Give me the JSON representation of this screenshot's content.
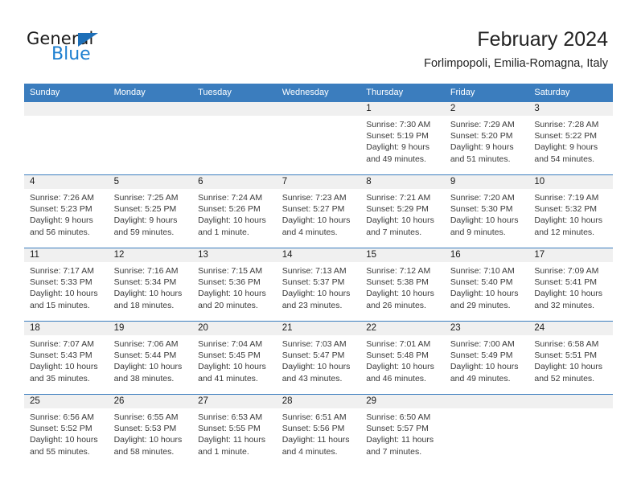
{
  "brand": {
    "name_top": "General",
    "name_bottom": "Blue",
    "accent_color": "#1d7fd0",
    "triangle_color": "#1d6fb8"
  },
  "header": {
    "title": "February 2024",
    "subtitle": "Forlimpopoli, Emilia-Romagna, Italy"
  },
  "theme": {
    "header_blue": "#3b7dbe",
    "band_gray": "#f0f0f0",
    "text_dark": "#1a1a1a",
    "text_body": "#3a3a3a"
  },
  "weekdays": [
    "Sunday",
    "Monday",
    "Tuesday",
    "Wednesday",
    "Thursday",
    "Friday",
    "Saturday"
  ],
  "weeks": [
    [
      {
        "day": "",
        "sunrise": "",
        "sunset": "",
        "daylight_line1": "",
        "daylight_line2": ""
      },
      {
        "day": "",
        "sunrise": "",
        "sunset": "",
        "daylight_line1": "",
        "daylight_line2": ""
      },
      {
        "day": "",
        "sunrise": "",
        "sunset": "",
        "daylight_line1": "",
        "daylight_line2": ""
      },
      {
        "day": "",
        "sunrise": "",
        "sunset": "",
        "daylight_line1": "",
        "daylight_line2": ""
      },
      {
        "day": "1",
        "sunrise": "Sunrise: 7:30 AM",
        "sunset": "Sunset: 5:19 PM",
        "daylight_line1": "Daylight: 9 hours",
        "daylight_line2": "and 49 minutes."
      },
      {
        "day": "2",
        "sunrise": "Sunrise: 7:29 AM",
        "sunset": "Sunset: 5:20 PM",
        "daylight_line1": "Daylight: 9 hours",
        "daylight_line2": "and 51 minutes."
      },
      {
        "day": "3",
        "sunrise": "Sunrise: 7:28 AM",
        "sunset": "Sunset: 5:22 PM",
        "daylight_line1": "Daylight: 9 hours",
        "daylight_line2": "and 54 minutes."
      }
    ],
    [
      {
        "day": "4",
        "sunrise": "Sunrise: 7:26 AM",
        "sunset": "Sunset: 5:23 PM",
        "daylight_line1": "Daylight: 9 hours",
        "daylight_line2": "and 56 minutes."
      },
      {
        "day": "5",
        "sunrise": "Sunrise: 7:25 AM",
        "sunset": "Sunset: 5:25 PM",
        "daylight_line1": "Daylight: 9 hours",
        "daylight_line2": "and 59 minutes."
      },
      {
        "day": "6",
        "sunrise": "Sunrise: 7:24 AM",
        "sunset": "Sunset: 5:26 PM",
        "daylight_line1": "Daylight: 10 hours",
        "daylight_line2": "and 1 minute."
      },
      {
        "day": "7",
        "sunrise": "Sunrise: 7:23 AM",
        "sunset": "Sunset: 5:27 PM",
        "daylight_line1": "Daylight: 10 hours",
        "daylight_line2": "and 4 minutes."
      },
      {
        "day": "8",
        "sunrise": "Sunrise: 7:21 AM",
        "sunset": "Sunset: 5:29 PM",
        "daylight_line1": "Daylight: 10 hours",
        "daylight_line2": "and 7 minutes."
      },
      {
        "day": "9",
        "sunrise": "Sunrise: 7:20 AM",
        "sunset": "Sunset: 5:30 PM",
        "daylight_line1": "Daylight: 10 hours",
        "daylight_line2": "and 9 minutes."
      },
      {
        "day": "10",
        "sunrise": "Sunrise: 7:19 AM",
        "sunset": "Sunset: 5:32 PM",
        "daylight_line1": "Daylight: 10 hours",
        "daylight_line2": "and 12 minutes."
      }
    ],
    [
      {
        "day": "11",
        "sunrise": "Sunrise: 7:17 AM",
        "sunset": "Sunset: 5:33 PM",
        "daylight_line1": "Daylight: 10 hours",
        "daylight_line2": "and 15 minutes."
      },
      {
        "day": "12",
        "sunrise": "Sunrise: 7:16 AM",
        "sunset": "Sunset: 5:34 PM",
        "daylight_line1": "Daylight: 10 hours",
        "daylight_line2": "and 18 minutes."
      },
      {
        "day": "13",
        "sunrise": "Sunrise: 7:15 AM",
        "sunset": "Sunset: 5:36 PM",
        "daylight_line1": "Daylight: 10 hours",
        "daylight_line2": "and 20 minutes."
      },
      {
        "day": "14",
        "sunrise": "Sunrise: 7:13 AM",
        "sunset": "Sunset: 5:37 PM",
        "daylight_line1": "Daylight: 10 hours",
        "daylight_line2": "and 23 minutes."
      },
      {
        "day": "15",
        "sunrise": "Sunrise: 7:12 AM",
        "sunset": "Sunset: 5:38 PM",
        "daylight_line1": "Daylight: 10 hours",
        "daylight_line2": "and 26 minutes."
      },
      {
        "day": "16",
        "sunrise": "Sunrise: 7:10 AM",
        "sunset": "Sunset: 5:40 PM",
        "daylight_line1": "Daylight: 10 hours",
        "daylight_line2": "and 29 minutes."
      },
      {
        "day": "17",
        "sunrise": "Sunrise: 7:09 AM",
        "sunset": "Sunset: 5:41 PM",
        "daylight_line1": "Daylight: 10 hours",
        "daylight_line2": "and 32 minutes."
      }
    ],
    [
      {
        "day": "18",
        "sunrise": "Sunrise: 7:07 AM",
        "sunset": "Sunset: 5:43 PM",
        "daylight_line1": "Daylight: 10 hours",
        "daylight_line2": "and 35 minutes."
      },
      {
        "day": "19",
        "sunrise": "Sunrise: 7:06 AM",
        "sunset": "Sunset: 5:44 PM",
        "daylight_line1": "Daylight: 10 hours",
        "daylight_line2": "and 38 minutes."
      },
      {
        "day": "20",
        "sunrise": "Sunrise: 7:04 AM",
        "sunset": "Sunset: 5:45 PM",
        "daylight_line1": "Daylight: 10 hours",
        "daylight_line2": "and 41 minutes."
      },
      {
        "day": "21",
        "sunrise": "Sunrise: 7:03 AM",
        "sunset": "Sunset: 5:47 PM",
        "daylight_line1": "Daylight: 10 hours",
        "daylight_line2": "and 43 minutes."
      },
      {
        "day": "22",
        "sunrise": "Sunrise: 7:01 AM",
        "sunset": "Sunset: 5:48 PM",
        "daylight_line1": "Daylight: 10 hours",
        "daylight_line2": "and 46 minutes."
      },
      {
        "day": "23",
        "sunrise": "Sunrise: 7:00 AM",
        "sunset": "Sunset: 5:49 PM",
        "daylight_line1": "Daylight: 10 hours",
        "daylight_line2": "and 49 minutes."
      },
      {
        "day": "24",
        "sunrise": "Sunrise: 6:58 AM",
        "sunset": "Sunset: 5:51 PM",
        "daylight_line1": "Daylight: 10 hours",
        "daylight_line2": "and 52 minutes."
      }
    ],
    [
      {
        "day": "25",
        "sunrise": "Sunrise: 6:56 AM",
        "sunset": "Sunset: 5:52 PM",
        "daylight_line1": "Daylight: 10 hours",
        "daylight_line2": "and 55 minutes."
      },
      {
        "day": "26",
        "sunrise": "Sunrise: 6:55 AM",
        "sunset": "Sunset: 5:53 PM",
        "daylight_line1": "Daylight: 10 hours",
        "daylight_line2": "and 58 minutes."
      },
      {
        "day": "27",
        "sunrise": "Sunrise: 6:53 AM",
        "sunset": "Sunset: 5:55 PM",
        "daylight_line1": "Daylight: 11 hours",
        "daylight_line2": "and 1 minute."
      },
      {
        "day": "28",
        "sunrise": "Sunrise: 6:51 AM",
        "sunset": "Sunset: 5:56 PM",
        "daylight_line1": "Daylight: 11 hours",
        "daylight_line2": "and 4 minutes."
      },
      {
        "day": "29",
        "sunrise": "Sunrise: 6:50 AM",
        "sunset": "Sunset: 5:57 PM",
        "daylight_line1": "Daylight: 11 hours",
        "daylight_line2": "and 7 minutes."
      },
      {
        "day": "",
        "sunrise": "",
        "sunset": "",
        "daylight_line1": "",
        "daylight_line2": ""
      },
      {
        "day": "",
        "sunrise": "",
        "sunset": "",
        "daylight_line1": "",
        "daylight_line2": ""
      }
    ]
  ]
}
